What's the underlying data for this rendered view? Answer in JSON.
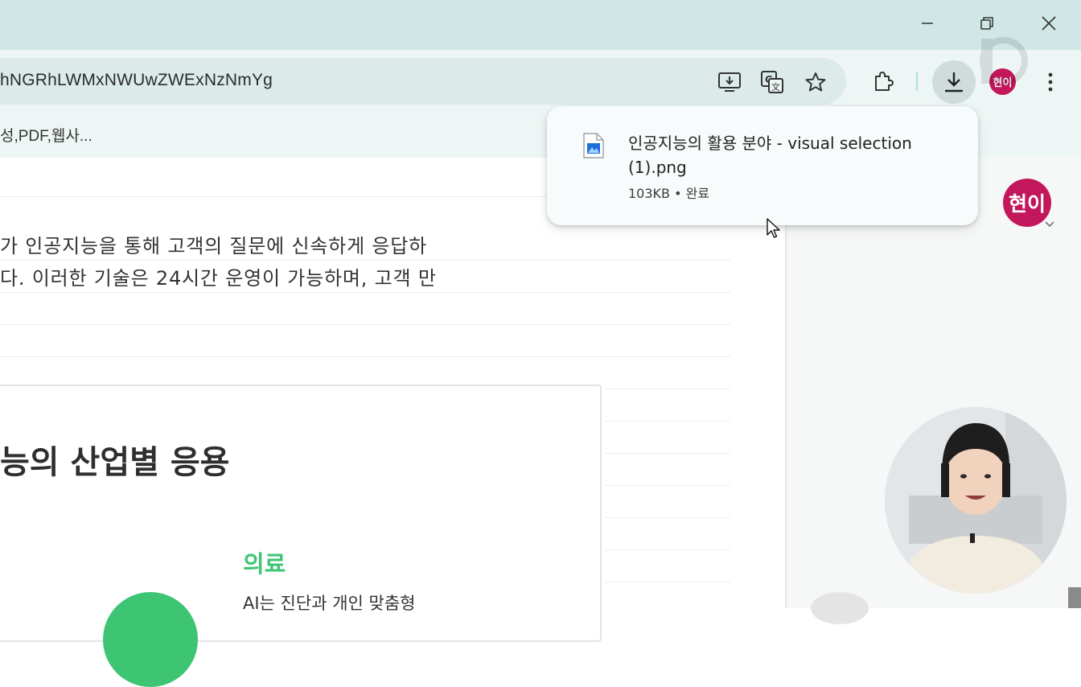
{
  "browser": {
    "url_fragment": "hNGRhLWMxNWUwZWExNzNmYg",
    "bookmark_fragment": "성,PDF,웹사...",
    "profile_initials": "현이"
  },
  "page": {
    "paragraph_line1": "가 인공지능을 통해 고객의 질문에 신속하게 응답하",
    "paragraph_line2": "다. 이러한 기술은 24시간 운영이 가능하며, 고객 만",
    "card_title": "능의 산업별 응용",
    "section_label": "의료",
    "section_text": "AI는 진단과 개인 맞춤형"
  },
  "downloads": {
    "file_name_line1": "인공지능의 활용 분야 - visual selection",
    "file_name_line2": "(1).png",
    "meta": "103KB • 완료"
  },
  "side_panel": {
    "avatar_initials": "현이"
  },
  "icons": {
    "minimize": "minimize-icon",
    "restore": "restore-icon",
    "close": "close-icon",
    "install": "install-app-icon",
    "translate": "translate-icon",
    "bookmark": "star-icon",
    "extensions": "puzzle-icon",
    "download": "download-icon",
    "menu": "kebab-menu-icon"
  },
  "colors": {
    "titlebar": "#cfe8e6",
    "accent_green": "#3dc573",
    "avatar": "#c2185b"
  }
}
